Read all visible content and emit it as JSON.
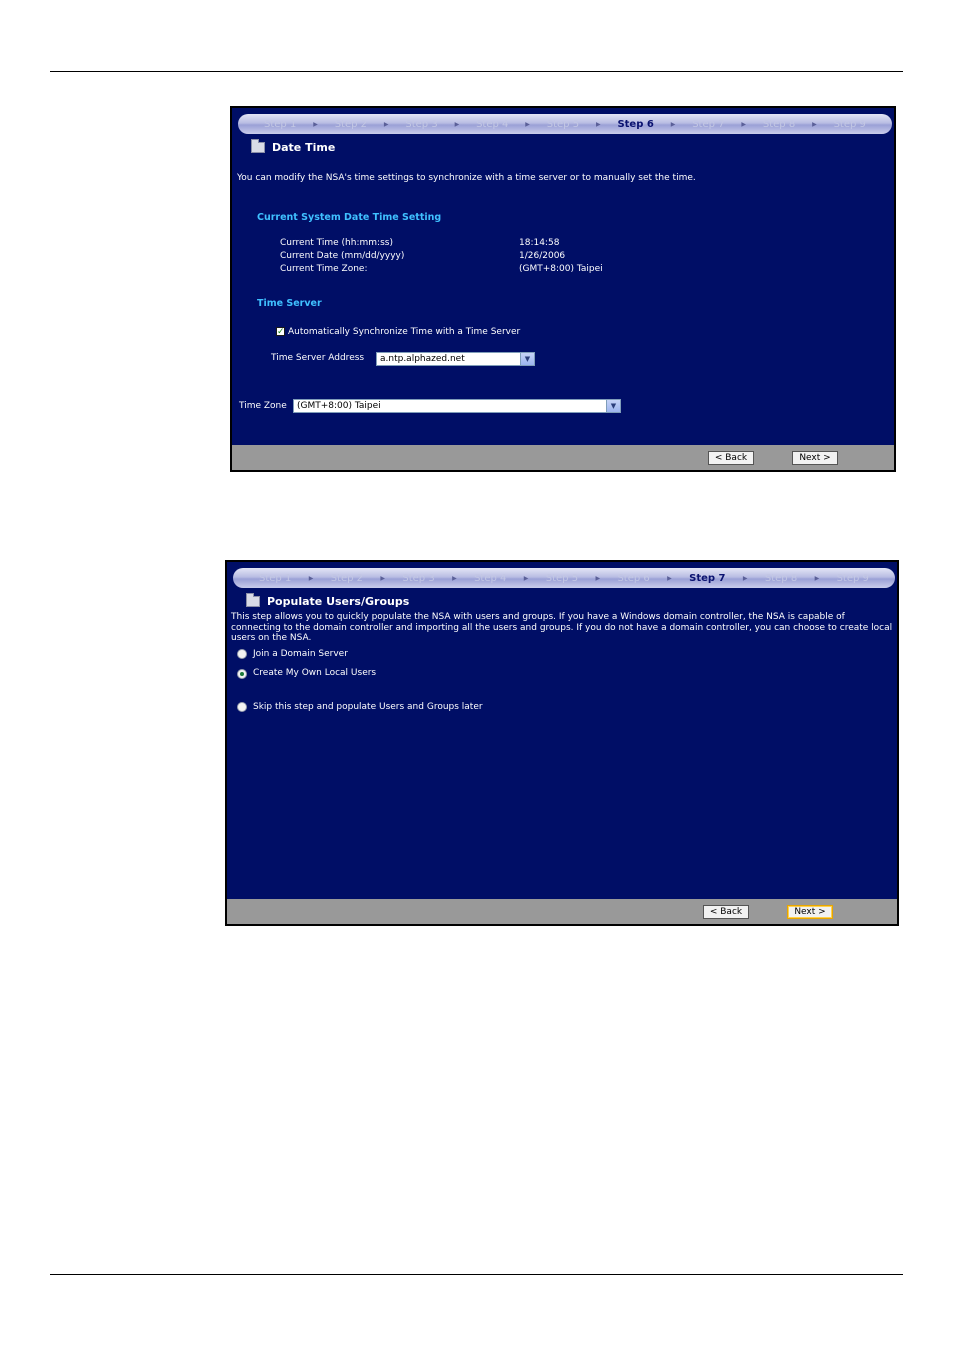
{
  "screen1": {
    "steps": [
      "Step 1",
      "Step 2",
      "Step 3",
      "Step 4",
      "Step 5",
      "Step 6",
      "Step 7",
      "Step 8",
      "Step 9"
    ],
    "active_step": 5,
    "title": "Date Time",
    "description": "You can modify the NSA's time settings to synchronize with a time server or to manually set the time.",
    "current_section": "Current System Date Time Setting",
    "rows": [
      {
        "label": "Current Time (hh:mm:ss)",
        "value": "18:14:58"
      },
      {
        "label": "Current Date (mm/dd/yyyy)",
        "value": "1/26/2006"
      },
      {
        "label": "Current Time Zone:",
        "value": "(GMT+8:00) Taipei"
      }
    ],
    "time_server_section": "Time Server",
    "auto_sync_label": "Automatically Synchronize Time with a Time Server",
    "auto_sync_checked": true,
    "server_address_label": "Time Server Address",
    "server_address_value": "a.ntp.alphazed.net",
    "time_zone_label": "Time Zone",
    "time_zone_value": "(GMT+8:00) Taipei",
    "back_label": "< Back",
    "next_label": "Next >"
  },
  "screen2": {
    "steps": [
      "Step 1",
      "Step 2",
      "Step 3",
      "Step 4",
      "Step 5",
      "Step 6",
      "Step 7",
      "Step 8",
      "Step 9"
    ],
    "active_step": 6,
    "title": "Populate Users/Groups",
    "description": "This step allows you to quickly populate the NSA with users and groups. If you have a Windows domain controller, the NSA is capable of connecting to the domain controller and importing all the users and groups. If you do not have a domain controller, you can choose to create local users on the NSA.",
    "options": [
      {
        "label": "Join a Domain Server",
        "checked": false
      },
      {
        "label": "Create My Own Local Users",
        "checked": true
      },
      {
        "label": "Skip this step and populate Users and Groups later",
        "checked": false
      }
    ],
    "back_label": "< Back",
    "next_label": "Next >"
  }
}
